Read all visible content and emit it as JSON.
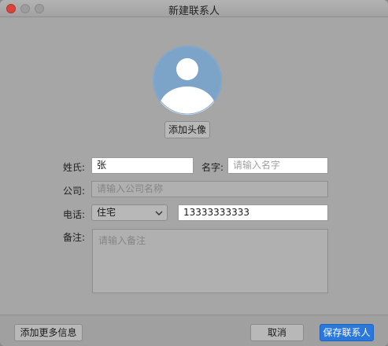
{
  "window": {
    "title": "新建联系人"
  },
  "avatar": {
    "add_button": "添加头像"
  },
  "form": {
    "surname_label": "姓氏:",
    "surname_value": "张",
    "given_name_label": "名字:",
    "given_name_placeholder": "请输入名字",
    "company_label": "公司:",
    "company_placeholder": "请输入公司名称",
    "phone_label": "电话:",
    "phone_type": "住宅",
    "phone_value": "13333333333",
    "note_label": "备注:",
    "note_placeholder": "请输入备注"
  },
  "footer": {
    "more_info_button": "添加更多信息",
    "cancel_button": "取消",
    "save_button": "保存联系人"
  },
  "colors": {
    "overlay_gray": "#a6a6a6",
    "avatar_blue": "#7ca3c8",
    "primary_button": "#2a78dc",
    "close_button": "#d9453c"
  },
  "icons": [
    "avatar-placeholder-icon",
    "chevron-down-icon"
  ]
}
